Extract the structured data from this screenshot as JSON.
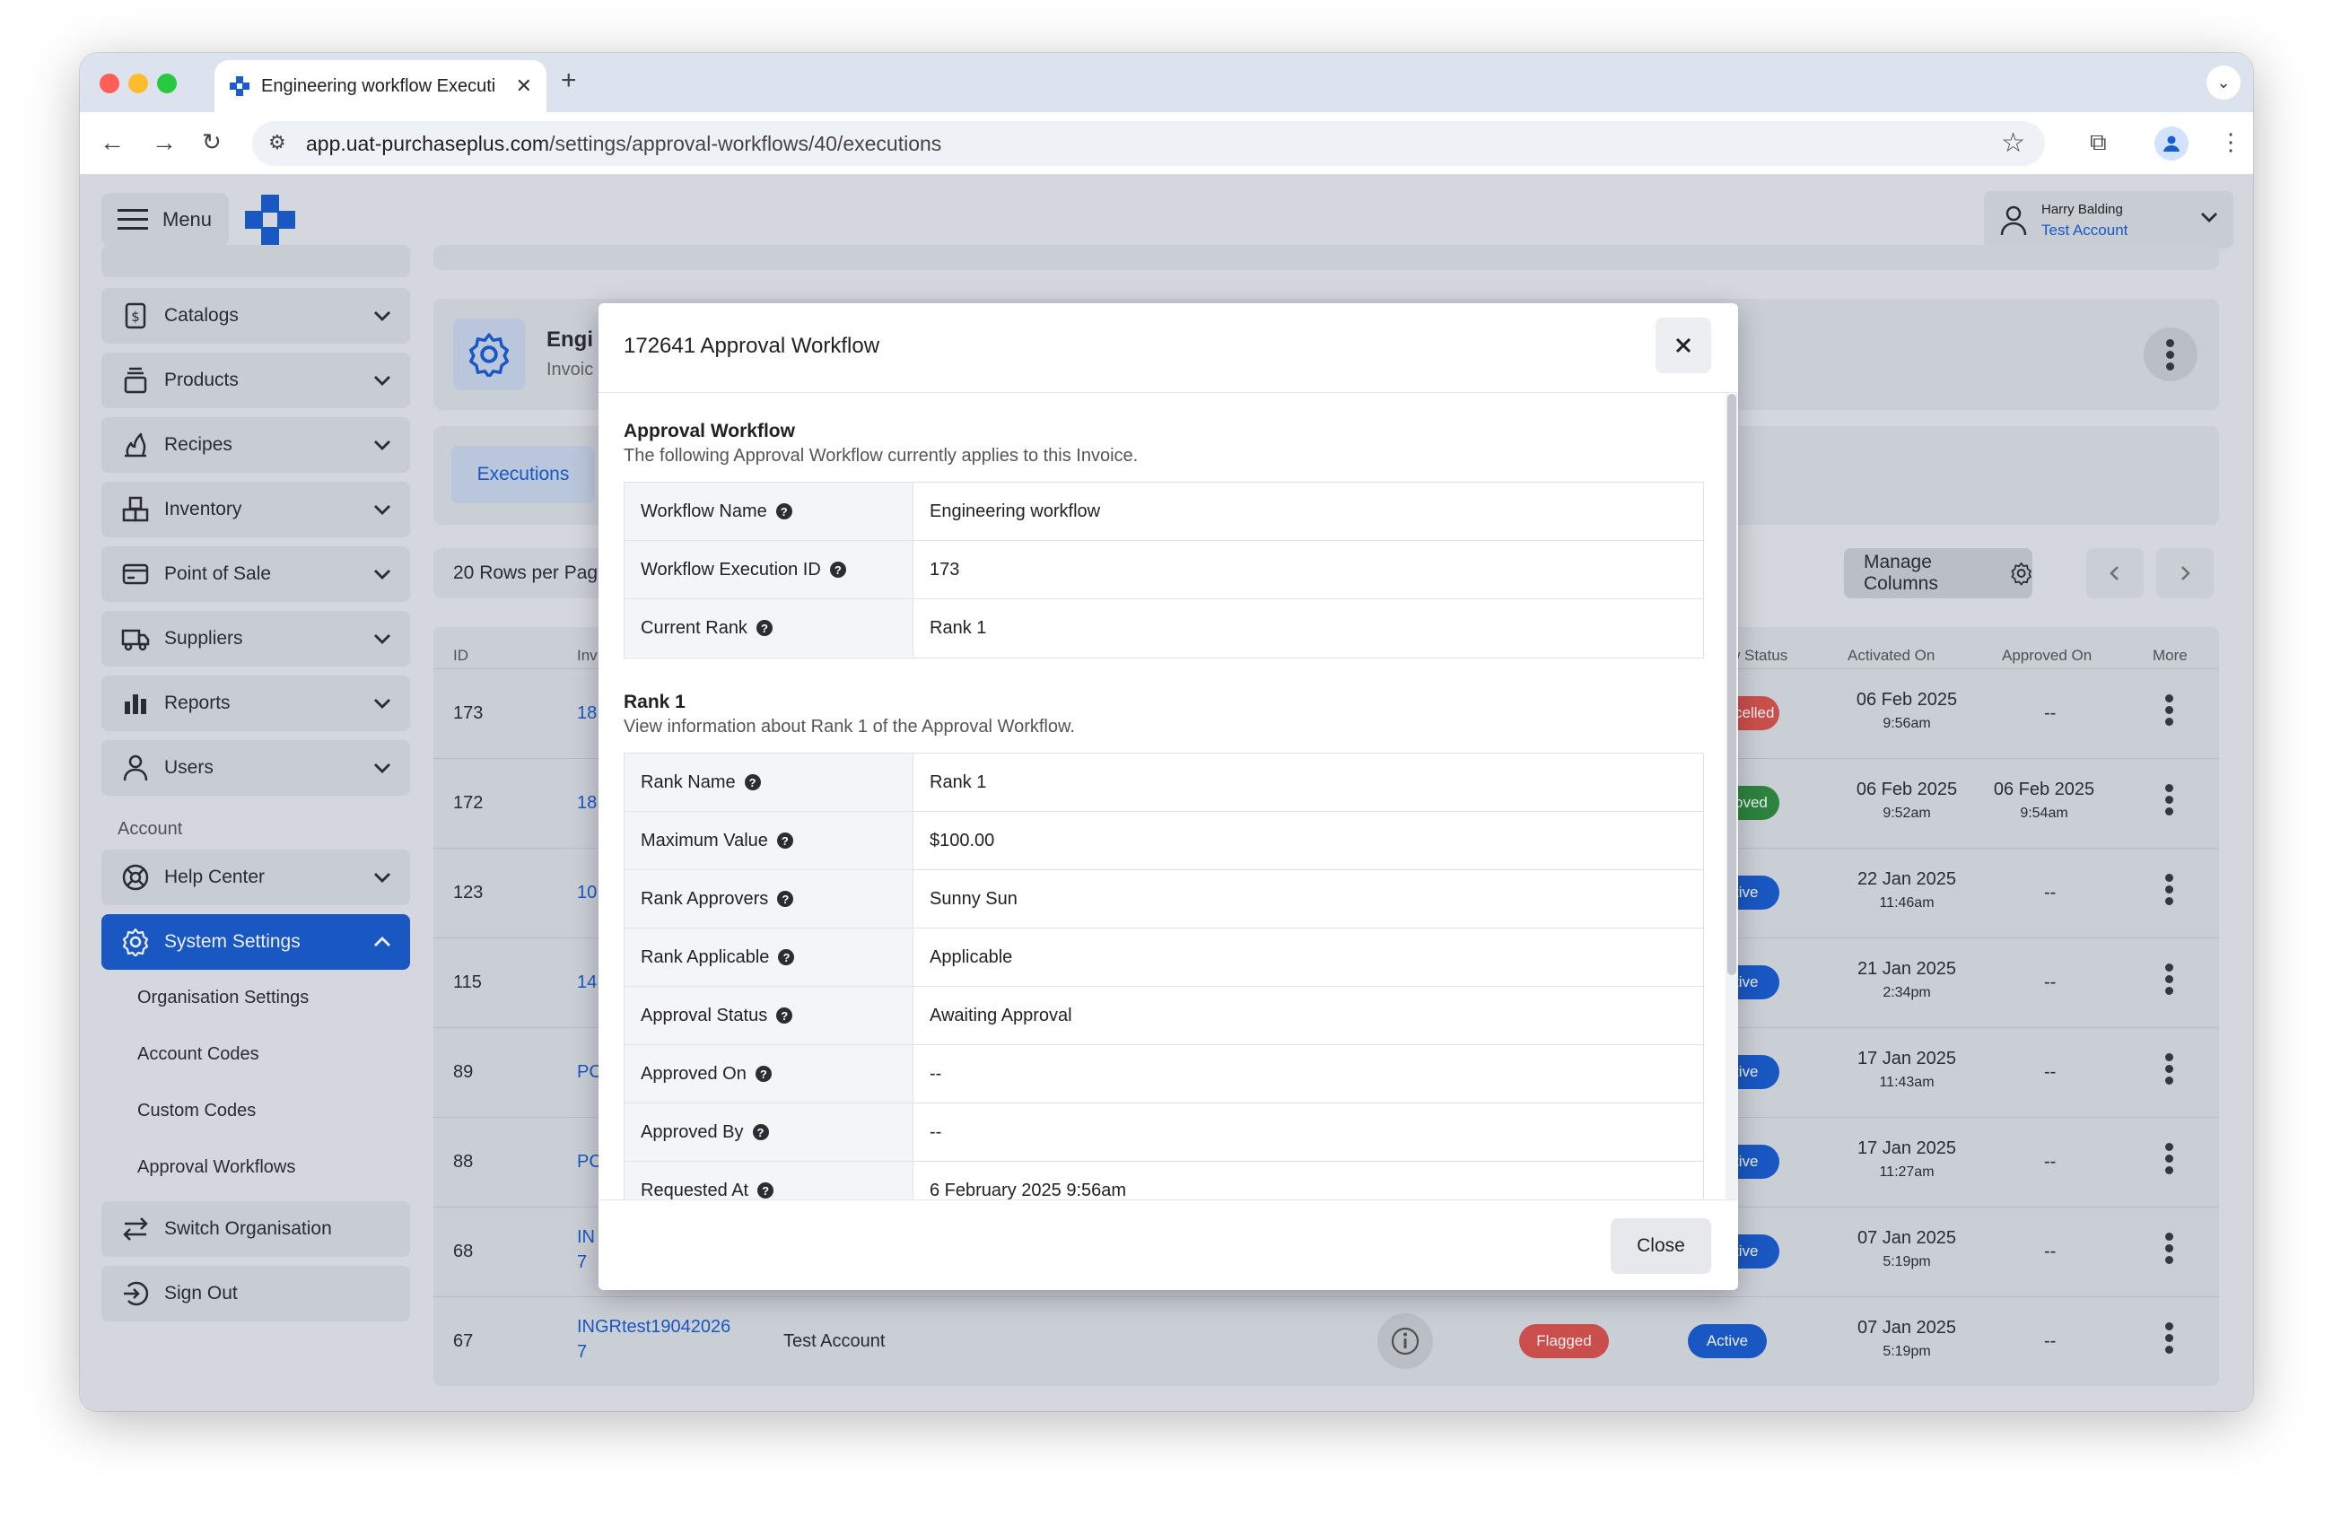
{
  "browser": {
    "tab_title": "Engineering workflow Executi",
    "url_host": "app.uat-purchaseplus.com",
    "url_path": "/settings/approval-workflows/40/executions"
  },
  "header": {
    "menu_label": "Menu",
    "user_name": "Harry Balding",
    "user_account": "Test Account"
  },
  "sidebar": {
    "items": [
      {
        "label": "Catalogs",
        "icon": "dollar-doc-icon"
      },
      {
        "label": "Products",
        "icon": "stack-icon"
      },
      {
        "label": "Recipes",
        "icon": "flame-icon"
      },
      {
        "label": "Inventory",
        "icon": "boxes-icon"
      },
      {
        "label": "Point of Sale",
        "icon": "card-icon"
      },
      {
        "label": "Suppliers",
        "icon": "truck-icon"
      },
      {
        "label": "Reports",
        "icon": "bar-chart-icon"
      },
      {
        "label": "Users",
        "icon": "user-icon"
      }
    ],
    "account_section_label": "Account",
    "help_center": "Help Center",
    "system_settings": "System Settings",
    "sub_items": [
      "Organisation Settings",
      "Account Codes",
      "Custom Codes",
      "Approval Workflows"
    ],
    "switch_org": "Switch Organisation",
    "sign_out": "Sign Out"
  },
  "page": {
    "title_partial": "Engi",
    "subtitle_partial": "Invoic",
    "tab_executions": "Executions",
    "rows_per_page": "20 Rows per Pag",
    "manage_columns": "Manage Columns"
  },
  "table": {
    "headers": {
      "id": "ID",
      "inv": "Inv",
      "status": "w Status",
      "activated": "Activated On",
      "approved": "Approved On",
      "more": "More"
    },
    "rows": [
      {
        "id": "173",
        "inv": "18",
        "status": "celled",
        "status_color": "#d9534f",
        "act_date": "06 Feb 2025",
        "act_time": "9:56am",
        "appr_date": "--",
        "appr_time": ""
      },
      {
        "id": "172",
        "inv": "18",
        "status": "oved",
        "status_color": "#2e8b3e",
        "act_date": "06 Feb 2025",
        "act_time": "9:52am",
        "appr_date": "06 Feb 2025",
        "appr_time": "9:54am"
      },
      {
        "id": "123",
        "inv": "10",
        "status": "tive",
        "status_color": "#1a5ccf",
        "act_date": "22 Jan 2025",
        "act_time": "11:46am",
        "appr_date": "--",
        "appr_time": ""
      },
      {
        "id": "115",
        "inv": "14",
        "status": "tive",
        "status_color": "#1a5ccf",
        "act_date": "21 Jan 2025",
        "act_time": "2:34pm",
        "appr_date": "--",
        "appr_time": ""
      },
      {
        "id": "89",
        "inv": "PC",
        "status": "tive",
        "status_color": "#1a5ccf",
        "act_date": "17 Jan 2025",
        "act_time": "11:43am",
        "appr_date": "--",
        "appr_time": ""
      },
      {
        "id": "88",
        "inv": "PC",
        "status": "tive",
        "status_color": "#1a5ccf",
        "act_date": "17 Jan 2025",
        "act_time": "11:27am",
        "appr_date": "--",
        "appr_time": ""
      },
      {
        "id": "68",
        "inv": "IN",
        "inv2": "7",
        "status": "tive",
        "status_color": "#1a5ccf",
        "act_date": "07 Jan 2025",
        "act_time": "5:19pm",
        "appr_date": "--",
        "appr_time": ""
      }
    ],
    "last_row": {
      "id": "67",
      "inv": "INGRtest19042026",
      "inv2": "7",
      "account": "Test Account",
      "flag": "Flagged",
      "status": "Active",
      "act_date": "07 Jan 2025",
      "act_time": "5:19pm",
      "appr_date": "--"
    }
  },
  "modal": {
    "title": "172641 Approval Workflow",
    "section1_title": "Approval Workflow",
    "section1_desc": "The following Approval Workflow currently applies to this Invoice.",
    "section1_rows": [
      {
        "key": "Workflow Name",
        "value": "Engineering workflow"
      },
      {
        "key": "Workflow Execution ID",
        "value": "173"
      },
      {
        "key": "Current Rank",
        "value": "Rank 1"
      }
    ],
    "section2_title": "Rank 1",
    "section2_desc": "View information about Rank 1 of the Approval Workflow.",
    "section2_rows": [
      {
        "key": "Rank Name",
        "value": "Rank 1"
      },
      {
        "key": "Maximum Value",
        "value": "$100.00"
      },
      {
        "key": "Rank Approvers",
        "value": "Sunny Sun"
      },
      {
        "key": "Rank Applicable",
        "value": "Applicable"
      },
      {
        "key": "Approval Status",
        "value": "Awaiting Approval"
      },
      {
        "key": "Approved On",
        "value": "--"
      },
      {
        "key": "Approved By",
        "value": "--"
      },
      {
        "key": "Requested At",
        "value": "6 February 2025 9:56am"
      }
    ],
    "close_label": "Close"
  },
  "colors": {
    "accent": "#1a5ccf",
    "danger": "#d9534f",
    "success": "#2e8b3e"
  }
}
